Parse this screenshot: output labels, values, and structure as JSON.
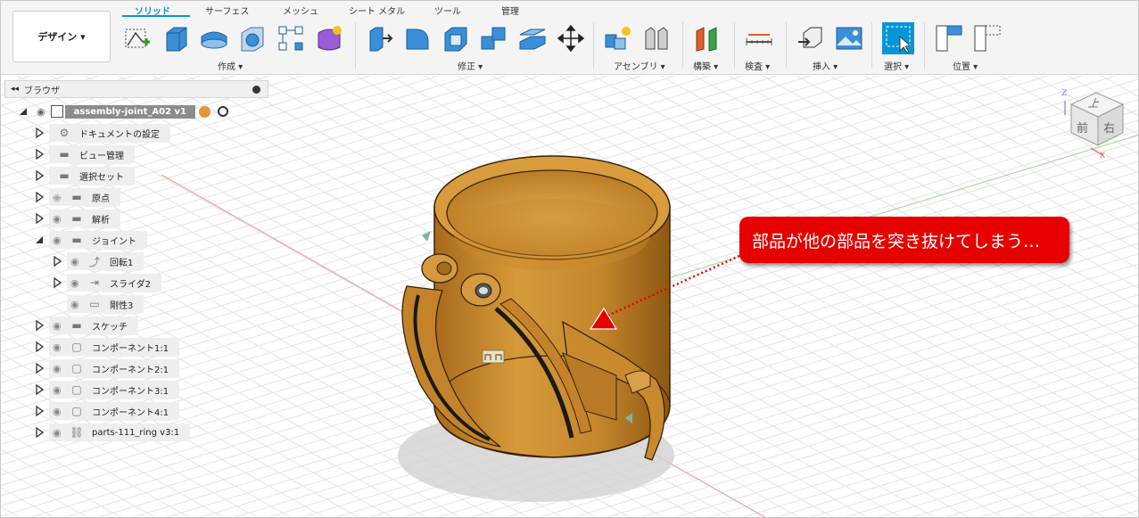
{
  "workspace": {
    "label": "デザイン ▾"
  },
  "tabs": [
    {
      "label": "ソリッド",
      "active": true
    },
    {
      "label": "サーフェス"
    },
    {
      "label": "メッシュ"
    },
    {
      "label": "シート メタル"
    },
    {
      "label": "ツール"
    },
    {
      "label": "管理"
    }
  ],
  "groups": {
    "create": "作成 ▾",
    "modify": "修正 ▾",
    "assemble": "アセンブリ ▾",
    "construct": "構築 ▾",
    "inspect": "検査 ▾",
    "insert": "挿入 ▾",
    "select": "選択 ▾",
    "position": "位置 ▾"
  },
  "browser": {
    "title": "ブラウザ",
    "root": "assembly-joint_A02 v1",
    "items": [
      {
        "label": "ドキュメントの設定",
        "icon": "gear-icon",
        "visible": null
      },
      {
        "label": "ビュー管理",
        "icon": "folder-icon",
        "visible": null
      },
      {
        "label": "選択セット",
        "icon": "folder-icon",
        "visible": null
      },
      {
        "label": "原点",
        "icon": "folder-icon",
        "visible": false
      },
      {
        "label": "解析",
        "icon": "folder-icon",
        "visible": true
      },
      {
        "label": "ジョイント",
        "icon": "folder-icon",
        "visible": true,
        "expanded": true
      },
      {
        "label": "回転1",
        "icon": "revolute-joint-icon",
        "visible": true,
        "child": true
      },
      {
        "label": "スライダ2",
        "icon": "slider-joint-icon",
        "visible": true,
        "child": true
      },
      {
        "label": "剛性3",
        "icon": "rigid-joint-icon",
        "visible": true,
        "child": true
      },
      {
        "label": "スケッチ",
        "icon": "folder-icon",
        "visible": true
      },
      {
        "label": "コンポーネント1:1",
        "icon": "component-icon",
        "visible": true
      },
      {
        "label": "コンポーネント2:1",
        "icon": "component-icon",
        "visible": true
      },
      {
        "label": "コンポーネント3:1",
        "icon": "component-icon",
        "visible": true
      },
      {
        "label": "コンポーネント4:1",
        "icon": "component-icon",
        "visible": true
      },
      {
        "label": "parts-111_ring v3:1",
        "icon": "link-icon",
        "visible": true
      }
    ]
  },
  "viewcube": {
    "top": "上",
    "front": "前",
    "right": "右",
    "axis_z": "Z",
    "axis_x": "X"
  },
  "callout": "部品が他の部品を突き抜けてしまう…",
  "colors": {
    "accent": "#0696d7",
    "callout": "#e60000",
    "part": "#c98a2a"
  }
}
